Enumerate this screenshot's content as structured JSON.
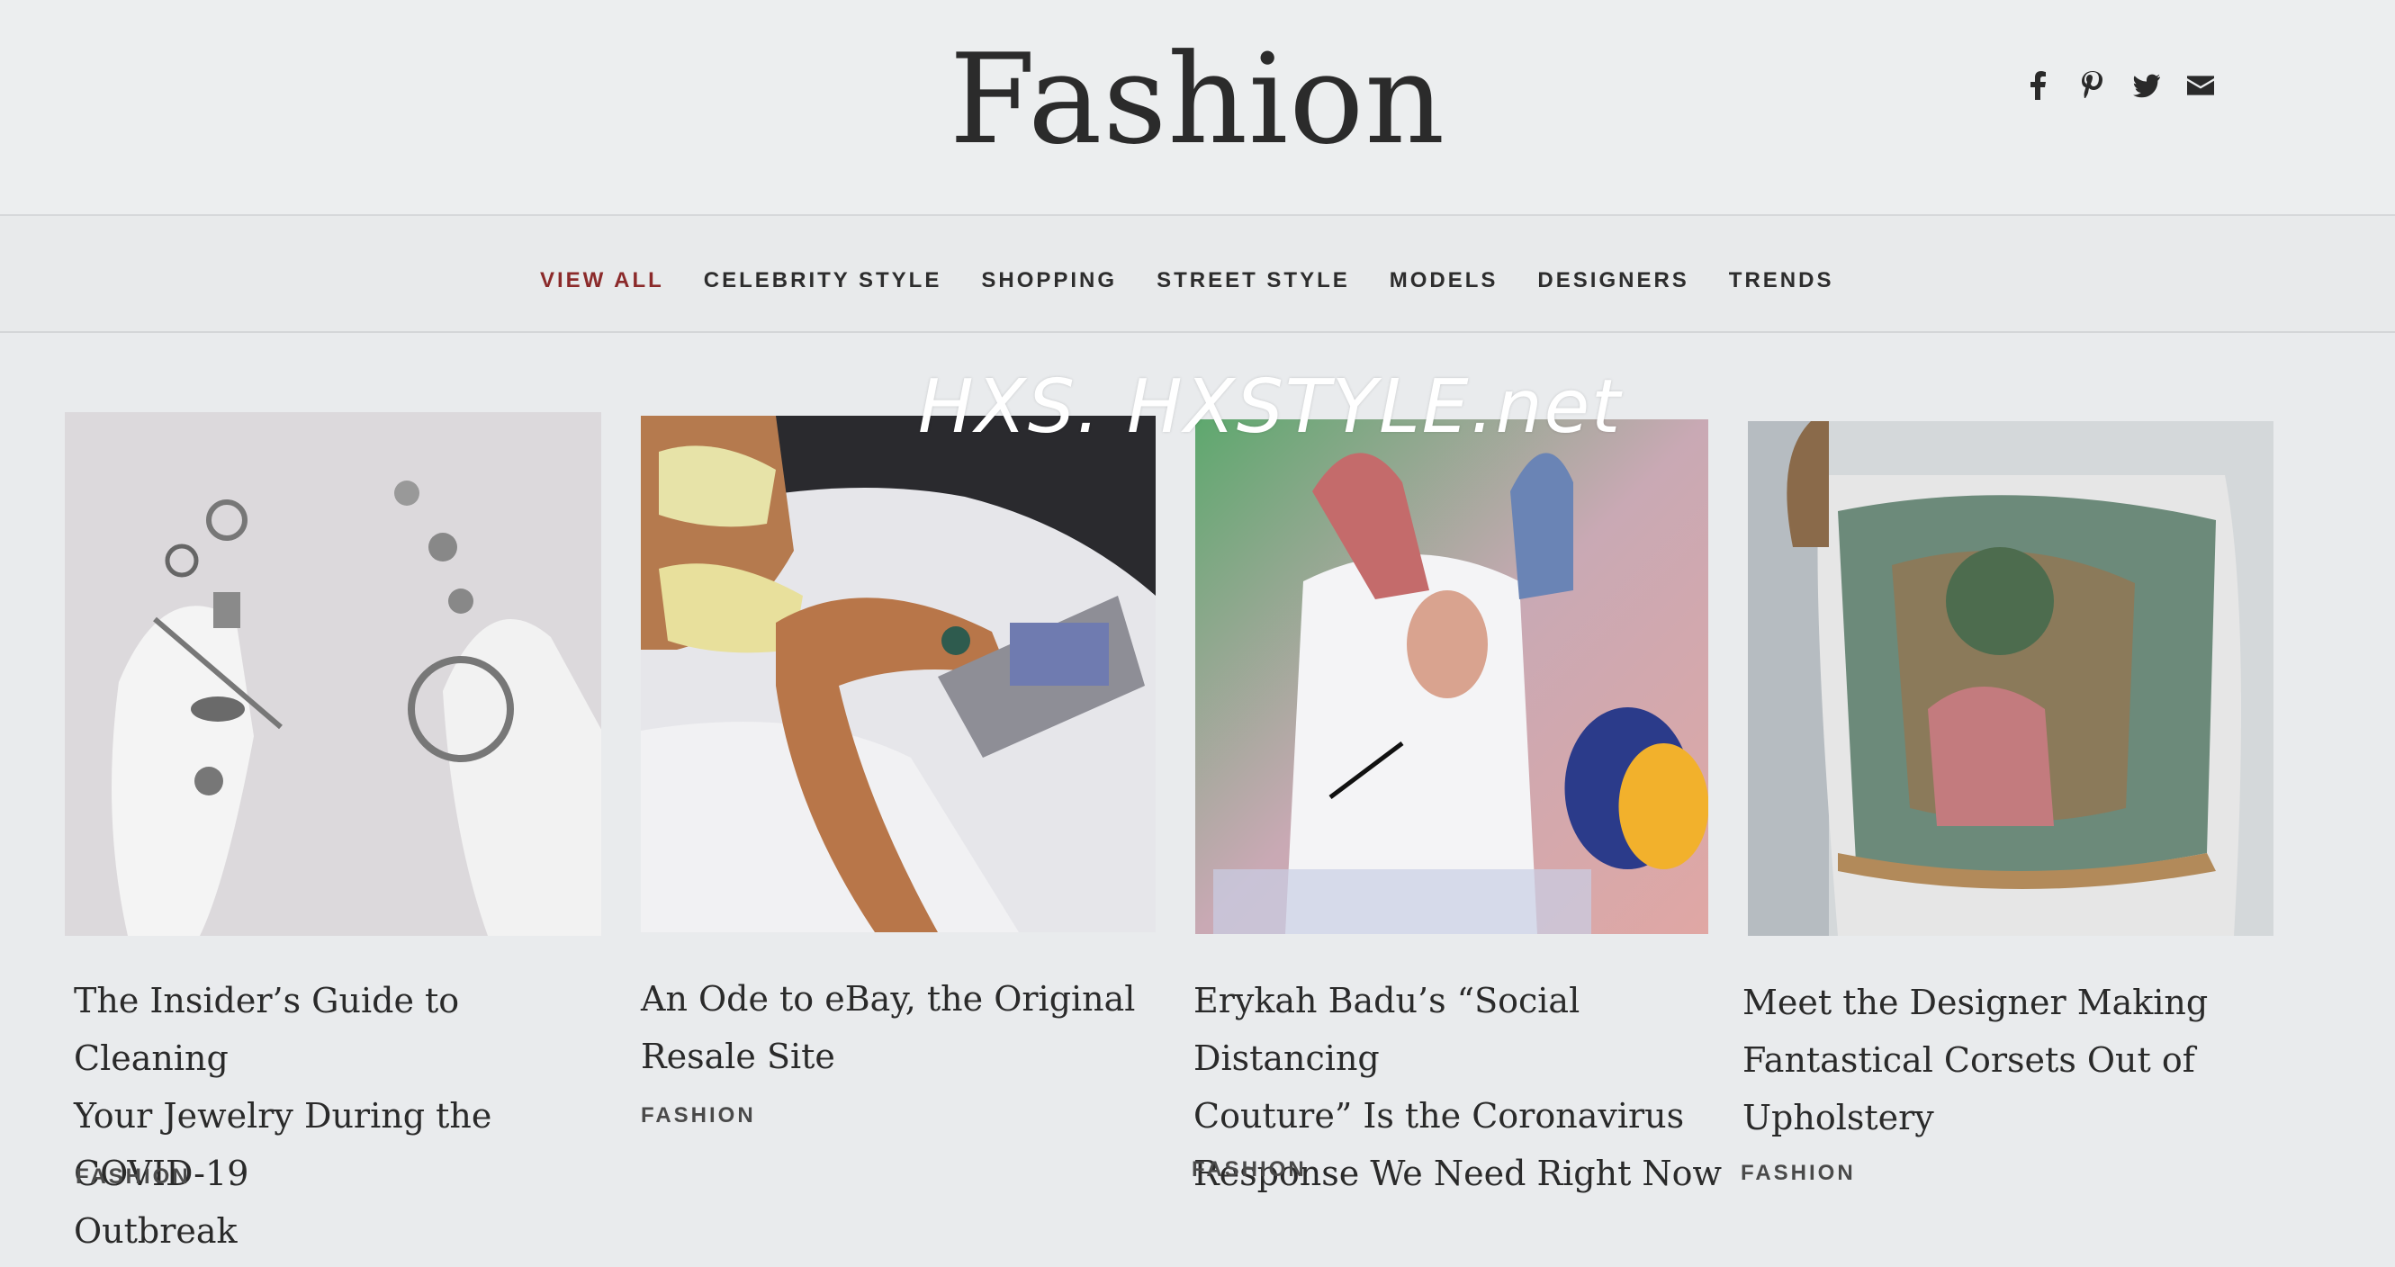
{
  "header": {
    "title": "Fashion"
  },
  "social": [
    {
      "name": "facebook-icon"
    },
    {
      "name": "pinterest-icon"
    },
    {
      "name": "twitter-icon"
    },
    {
      "name": "email-icon"
    }
  ],
  "nav": {
    "items": [
      {
        "label": "VIEW ALL",
        "active": true
      },
      {
        "label": "CELEBRITY STYLE"
      },
      {
        "label": "SHOPPING"
      },
      {
        "label": "STREET STYLE"
      },
      {
        "label": "MODELS"
      },
      {
        "label": "DESIGNERS"
      },
      {
        "label": "TRENDS"
      }
    ]
  },
  "watermark": "HXS. HXSTYLE.net",
  "articles": [
    {
      "title_lines": [
        "The Insider’s Guide to Cleaning",
        "Your Jewelry During the COVID-19",
        "Outbreak"
      ],
      "tag": "FASHION"
    },
    {
      "title_lines": [
        "An Ode to eBay, the Original",
        "Resale Site"
      ],
      "tag": "FASHION"
    },
    {
      "title_lines": [
        "Erykah Badu’s “Social Distancing",
        "Couture” Is the Coronavirus",
        "Response We Need Right Now"
      ],
      "tag": "FASHION"
    },
    {
      "title_lines": [
        "Meet the Designer Making",
        "Fantastical Corsets Out of",
        "Upholstery"
      ],
      "tag": "FASHION"
    }
  ]
}
